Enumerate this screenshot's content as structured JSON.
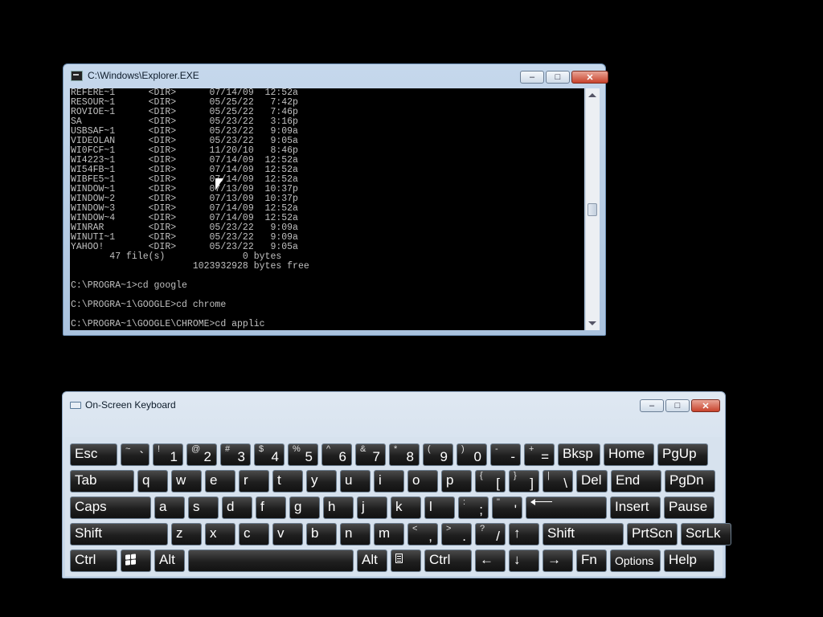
{
  "console": {
    "title": "C:\\Windows\\Explorer.EXE",
    "lines": [
      "REFERE~1      <DIR>      07/14/09  12:52a",
      "RESOUR~1      <DIR>      05/25/22   7:42p",
      "ROVIOE~1      <DIR>      05/25/22   7:46p",
      "SA            <DIR>      05/23/22   3:16p",
      "USBSAF~1      <DIR>      05/23/22   9:09a",
      "VIDEOLAN      <DIR>      05/23/22   9:05a",
      "WI0FCF~1      <DIR>      11/20/10   8:46p",
      "WI4223~1      <DIR>      07/14/09  12:52a",
      "WI54FB~1      <DIR>      07/14/09  12:52a",
      "WIBFE5~1      <DIR>      07/14/09  12:52a",
      "WINDOW~1      <DIR>      07/13/09  10:37p",
      "WINDOW~2      <DIR>      07/13/09  10:37p",
      "WINDOW~3      <DIR>      07/14/09  12:52a",
      "WINDOW~4      <DIR>      07/14/09  12:52a",
      "WINRAR        <DIR>      05/23/22   9:09a",
      "WINUTI~1      <DIR>      05/23/22   9:09a",
      "YAHOO!        <DIR>      05/23/22   9:05a",
      "       47 file(s)              0 bytes",
      "                      1023932928 bytes free",
      "",
      "C:\\PROGRA~1>cd google",
      "",
      "C:\\PROGRA~1\\GOOGLE>cd chrome",
      "",
      "C:\\PROGRA~1\\GOOGLE\\CHROME>cd applic"
    ]
  },
  "osk": {
    "title": "On-Screen Keyboard",
    "rows": [
      [
        {
          "label": "Esc"
        },
        {
          "top": "~",
          "main": "`"
        },
        {
          "top": "!",
          "main": "1"
        },
        {
          "top": "@",
          "main": "2"
        },
        {
          "top": "#",
          "main": "3"
        },
        {
          "top": "$",
          "main": "4"
        },
        {
          "top": "%",
          "main": "5"
        },
        {
          "top": "^",
          "main": "6"
        },
        {
          "top": "&",
          "main": "7"
        },
        {
          "top": "*",
          "main": "8"
        },
        {
          "top": "(",
          "main": "9"
        },
        {
          "top": ")",
          "main": "0"
        },
        {
          "top": "-",
          "main": "-"
        },
        {
          "top": "+",
          "main": "="
        },
        {
          "label": "Bksp"
        },
        {
          "label": "Home"
        },
        {
          "label": "PgUp"
        }
      ],
      [
        {
          "label": "Tab"
        },
        {
          "label": "q"
        },
        {
          "label": "w"
        },
        {
          "label": "e"
        },
        {
          "label": "r"
        },
        {
          "label": "t"
        },
        {
          "label": "y"
        },
        {
          "label": "u"
        },
        {
          "label": "i"
        },
        {
          "label": "o"
        },
        {
          "label": "p"
        },
        {
          "top": "{",
          "main": "["
        },
        {
          "top": "}",
          "main": "]"
        },
        {
          "top": "|",
          "main": "\\"
        },
        {
          "label": "Del"
        },
        {
          "label": "End"
        },
        {
          "label": "PgDn"
        }
      ],
      [
        {
          "label": "Caps"
        },
        {
          "label": "a"
        },
        {
          "label": "s"
        },
        {
          "label": "d"
        },
        {
          "label": "f"
        },
        {
          "label": "g"
        },
        {
          "label": "h"
        },
        {
          "label": "j"
        },
        {
          "label": "k"
        },
        {
          "label": "l"
        },
        {
          "top": ":",
          "main": ";"
        },
        {
          "top": "\"",
          "main": "'"
        },
        {
          "icon": "enter-arrow-icon"
        },
        {
          "label": "Insert"
        },
        {
          "label": "Pause"
        }
      ],
      [
        {
          "label": "Shift"
        },
        {
          "label": "z"
        },
        {
          "label": "x"
        },
        {
          "label": "c"
        },
        {
          "label": "v"
        },
        {
          "label": "b"
        },
        {
          "label": "n"
        },
        {
          "label": "m"
        },
        {
          "top": "<",
          "main": ","
        },
        {
          "top": ">",
          "main": "."
        },
        {
          "top": "?",
          "main": "/"
        },
        {
          "label": "↑"
        },
        {
          "label": "Shift"
        },
        {
          "label": "PrtScn"
        },
        {
          "label": "ScrLk"
        }
      ],
      [
        {
          "label": "Ctrl"
        },
        {
          "icon": "windows-logo-icon"
        },
        {
          "label": "Alt"
        },
        {
          "label": ""
        },
        {
          "label": "Alt"
        },
        {
          "icon": "menu-key-icon"
        },
        {
          "label": "Ctrl"
        },
        {
          "label": "←"
        },
        {
          "label": "↓"
        },
        {
          "label": "→"
        },
        {
          "label": "Fn"
        },
        {
          "label": "Options"
        },
        {
          "label": "Help"
        }
      ]
    ]
  }
}
